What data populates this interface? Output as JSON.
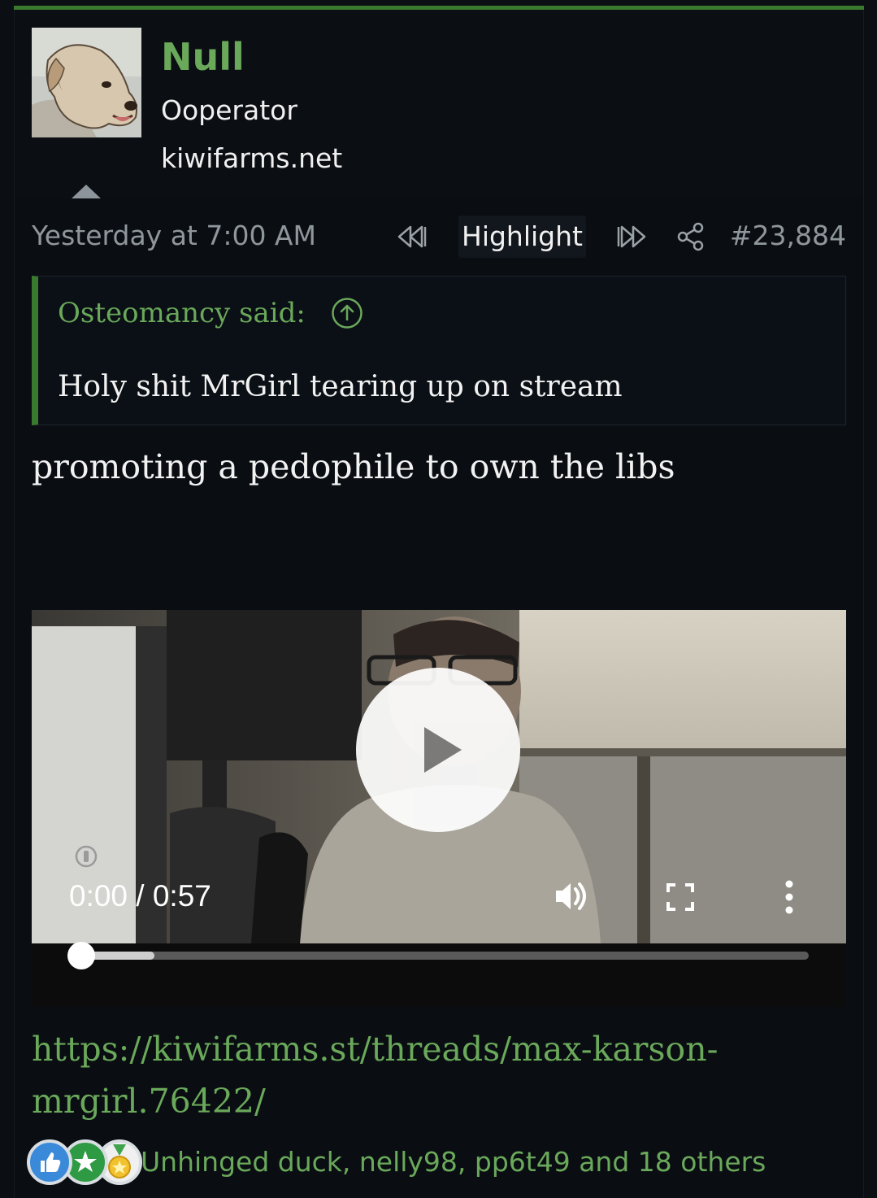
{
  "post": {
    "author": {
      "username": "Null",
      "user_title": "Ooperator",
      "site": "kiwifarms.net"
    },
    "meta": {
      "date": "Yesterday at 7:00 AM",
      "highlight_label": "Highlight",
      "post_number": "#23,884"
    },
    "quote": {
      "author": "Osteomancy said:",
      "text": "Holy shit MrGirl tearing up on stream"
    },
    "body": "promoting a pedophile to own the libs",
    "video": {
      "time": "0:00 / 0:57",
      "progress": 0.0,
      "buffered": 0.1
    },
    "link": "https://kiwifarms.st/threads/max-karson-mrgirl.76422/",
    "reactions": {
      "icons": [
        "like-icon",
        "winner-icon",
        "medal-icon"
      ],
      "users": "Unhinged duck, nelly98, pp6t49 and 18 others"
    }
  },
  "colors": {
    "accent_green": "#6aa85a",
    "border_green": "#3a7a2f",
    "background": "#0b0f14",
    "muted_text": "#8f969c"
  }
}
